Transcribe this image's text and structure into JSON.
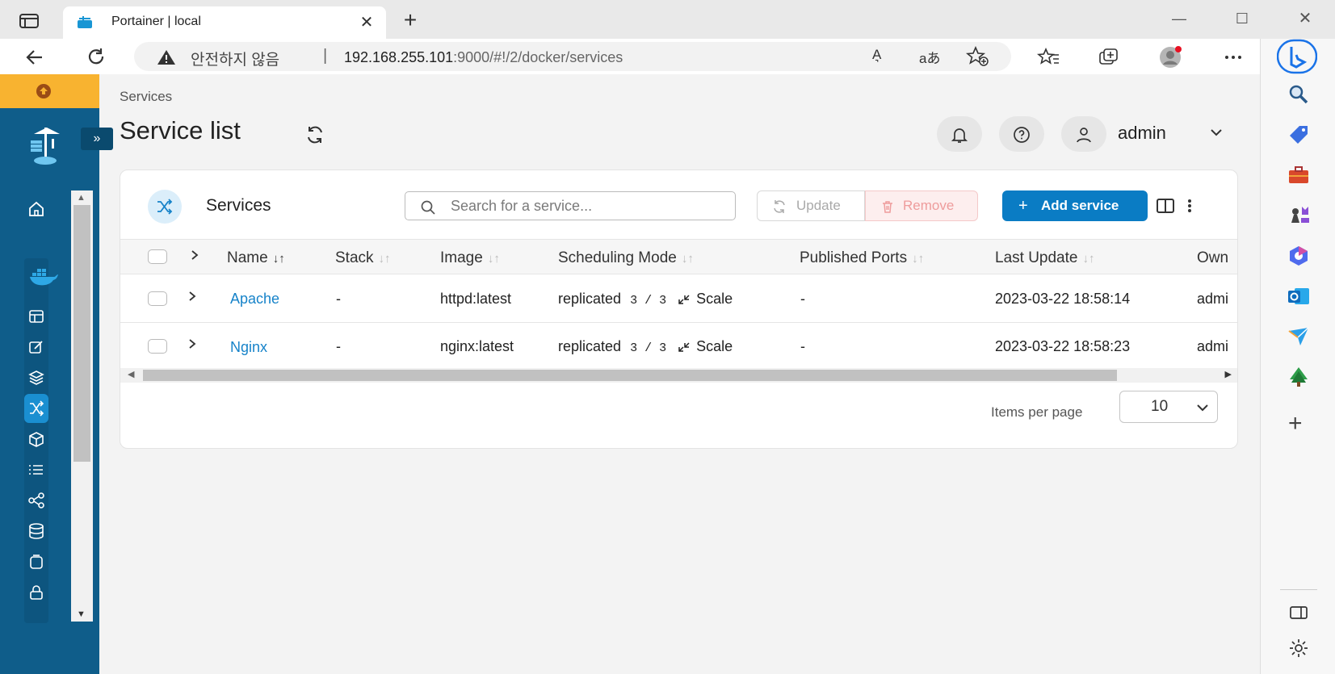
{
  "browser": {
    "tab_title": "Portainer | local",
    "tab_close": "✕",
    "new_tab": "+",
    "insecure_label": "안전하지 않음",
    "separator": "|",
    "url_host": "192.168.255.101",
    "url_path": ":9000/#!/2/docker/services",
    "read_aloud": "A͉",
    "translate": "aあ",
    "window_minimize": "—",
    "window_maximize": "☐",
    "window_close": "✕"
  },
  "page": {
    "breadcrumb": "Services",
    "title": "Service list",
    "user": "admin"
  },
  "sidebar": {
    "collapse_label": "»"
  },
  "services_panel": {
    "title": "Services",
    "search_placeholder": "Search for a service...",
    "update_label": "Update",
    "remove_label": "Remove",
    "add_label": "Add service",
    "add_plus": "+"
  },
  "table": {
    "columns": [
      {
        "label": "Name",
        "sort": "↓↑"
      },
      {
        "label": "Stack",
        "sort": "↓↑"
      },
      {
        "label": "Image",
        "sort": "↓↑"
      },
      {
        "label": "Scheduling Mode",
        "sort": "↓↑"
      },
      {
        "label": "Published Ports",
        "sort": "↓↑"
      },
      {
        "label": "Last Update",
        "sort": "↓↑"
      },
      {
        "label": "Own",
        "sort": ""
      }
    ],
    "rows": [
      {
        "name": "Apache",
        "stack": "-",
        "image": "httpd:latest",
        "mode": "replicated",
        "replicas": "3 / 3",
        "scale": "Scale",
        "ports": "-",
        "updated": "2023-03-22 18:58:14",
        "owner": "admi"
      },
      {
        "name": "Nginx",
        "stack": "-",
        "image": "nginx:latest",
        "mode": "replicated",
        "replicas": "3 / 3",
        "scale": "Scale",
        "ports": "-",
        "updated": "2023-03-22 18:58:23",
        "owner": "admi"
      }
    ]
  },
  "pagination": {
    "items_per_page_label": "Items per page",
    "items_per_page_value": "10"
  },
  "colors": {
    "sidebar": "#0f5d8a",
    "accent": "#0a7cc4",
    "banner": "#f8b330",
    "link": "#1783c9"
  }
}
